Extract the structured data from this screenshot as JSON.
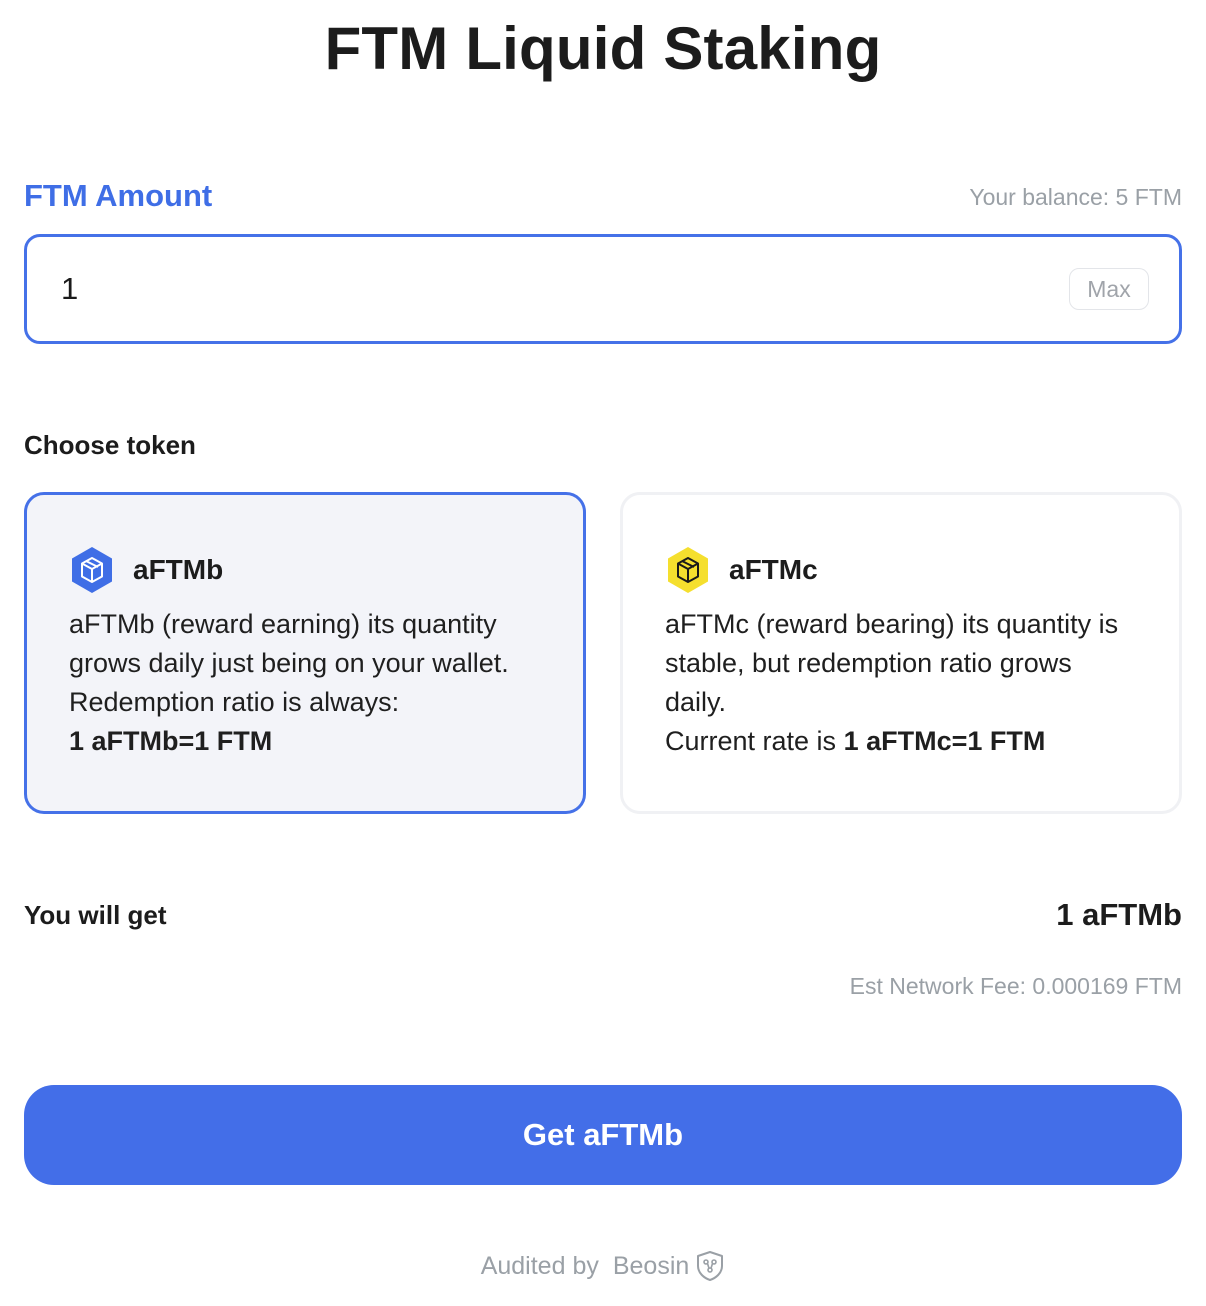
{
  "page": {
    "title": "FTM Liquid Staking"
  },
  "amount": {
    "label": "FTM Amount",
    "balance": "Your balance: 5 FTM",
    "value": "1",
    "max_label": "Max"
  },
  "tokens": {
    "label": "Choose token",
    "items": [
      {
        "name": "aFTMb",
        "icon": "aftmb-token-icon",
        "color": "#3f6ee6",
        "description": "aFTMb (reward earning) its quantity grows daily just being on your wallet. Redemption ratio is always:",
        "rate": "1 aFTMb=1 FTM",
        "selected": true
      },
      {
        "name": "aFTMc",
        "icon": "aftmc-token-icon",
        "color": "#f5df2e",
        "description": "aFTMc (reward bearing) its quantity is stable, but redemption ratio grows daily.",
        "rate_prefix": "Current rate is",
        "rate": "1 aFTMc=1 FTM",
        "selected": false
      }
    ]
  },
  "summary": {
    "label": "You will get",
    "value": "1 aFTMb",
    "fee": "Est Network Fee: 0.000169 FTM"
  },
  "cta": {
    "label": "Get aFTMb",
    "color": "#436ee8"
  },
  "footer": {
    "audited_by": "Audited by",
    "auditor": "Beosin",
    "auditor_icon": "beosin-shield-icon"
  }
}
